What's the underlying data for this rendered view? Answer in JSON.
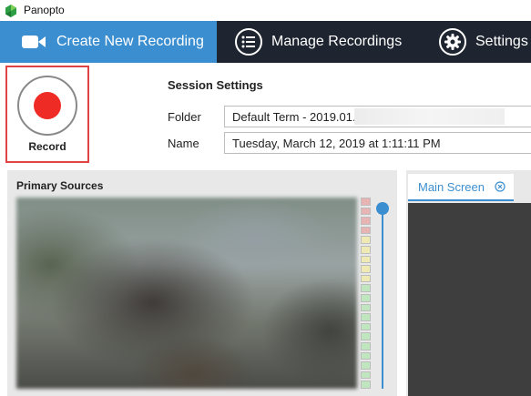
{
  "window": {
    "title": "Panopto",
    "logo_icon": "panopto-logo-icon"
  },
  "nav": {
    "tabs": [
      {
        "label": "Create New Recording",
        "icon": "camera-icon",
        "active": true
      },
      {
        "label": "Manage Recordings",
        "icon": "list-icon",
        "active": false
      },
      {
        "label": "Settings",
        "icon": "gear-icon",
        "active": false
      }
    ]
  },
  "record": {
    "label": "Record",
    "icon": "record-dot-icon"
  },
  "session": {
    "title": "Session Settings",
    "folder_label": "Folder",
    "folder_value": "Default Term - 2019.01.",
    "name_label": "Name",
    "name_value": "Tuesday, March 12, 2019 at 1:11:11 PM"
  },
  "sources": {
    "title": "Primary Sources",
    "meter_colors": [
      "#e7b3b3",
      "#e7b3b3",
      "#e7b3b3",
      "#e7b3b3",
      "#efe9b3",
      "#efe9b3",
      "#efe9b3",
      "#efe9b3",
      "#efe9b3",
      "#bfe6bf",
      "#bfe6bf",
      "#bfe6bf",
      "#bfe6bf",
      "#bfe6bf",
      "#bfe6bf",
      "#bfe6bf",
      "#bfe6bf",
      "#bfe6bf",
      "#bfe6bf",
      "#bfe6bf"
    ]
  },
  "main_screen": {
    "tab_label": "Main Screen",
    "close_icon": "close-circle-icon"
  },
  "colors": {
    "accent": "#3b8fd0",
    "navbar": "#1e2530",
    "record_red": "#ee2b24",
    "highlight_border": "#e04545"
  }
}
